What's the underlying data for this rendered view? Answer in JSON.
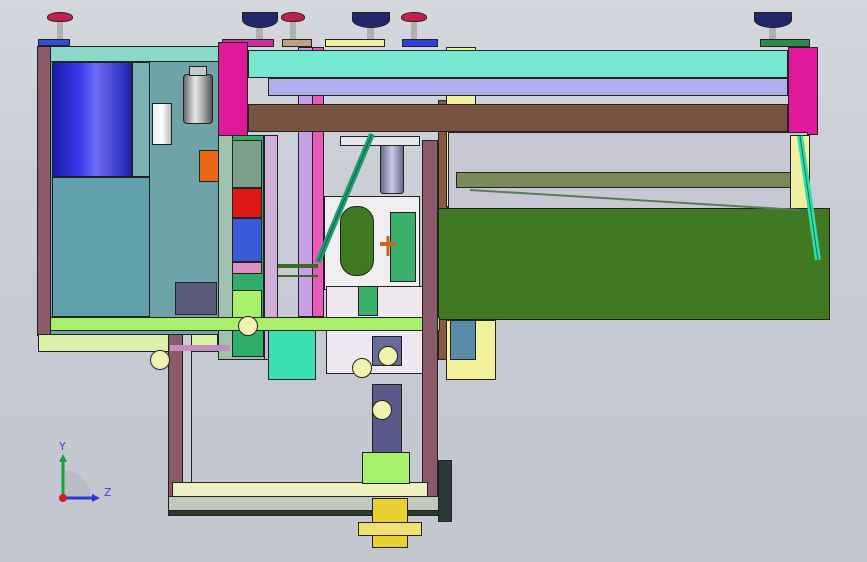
{
  "viewport": {
    "background": "#c9ccd4"
  },
  "triad": {
    "y_label": "Y",
    "z_label": "Z"
  },
  "colors": {
    "magenta": "#e0189a",
    "cyan": "#6ee0cf",
    "lavender": "#a8a8e8",
    "brown": "#8a5a40",
    "olive": "#3f7a22",
    "lime": "#a8f06a",
    "yellow": "#f2f29a",
    "maroon": "#8a5a6a",
    "steel_blue": "#5a8a9a",
    "knob_blue": "#2a2a80",
    "knob_red": "#d0306a"
  }
}
